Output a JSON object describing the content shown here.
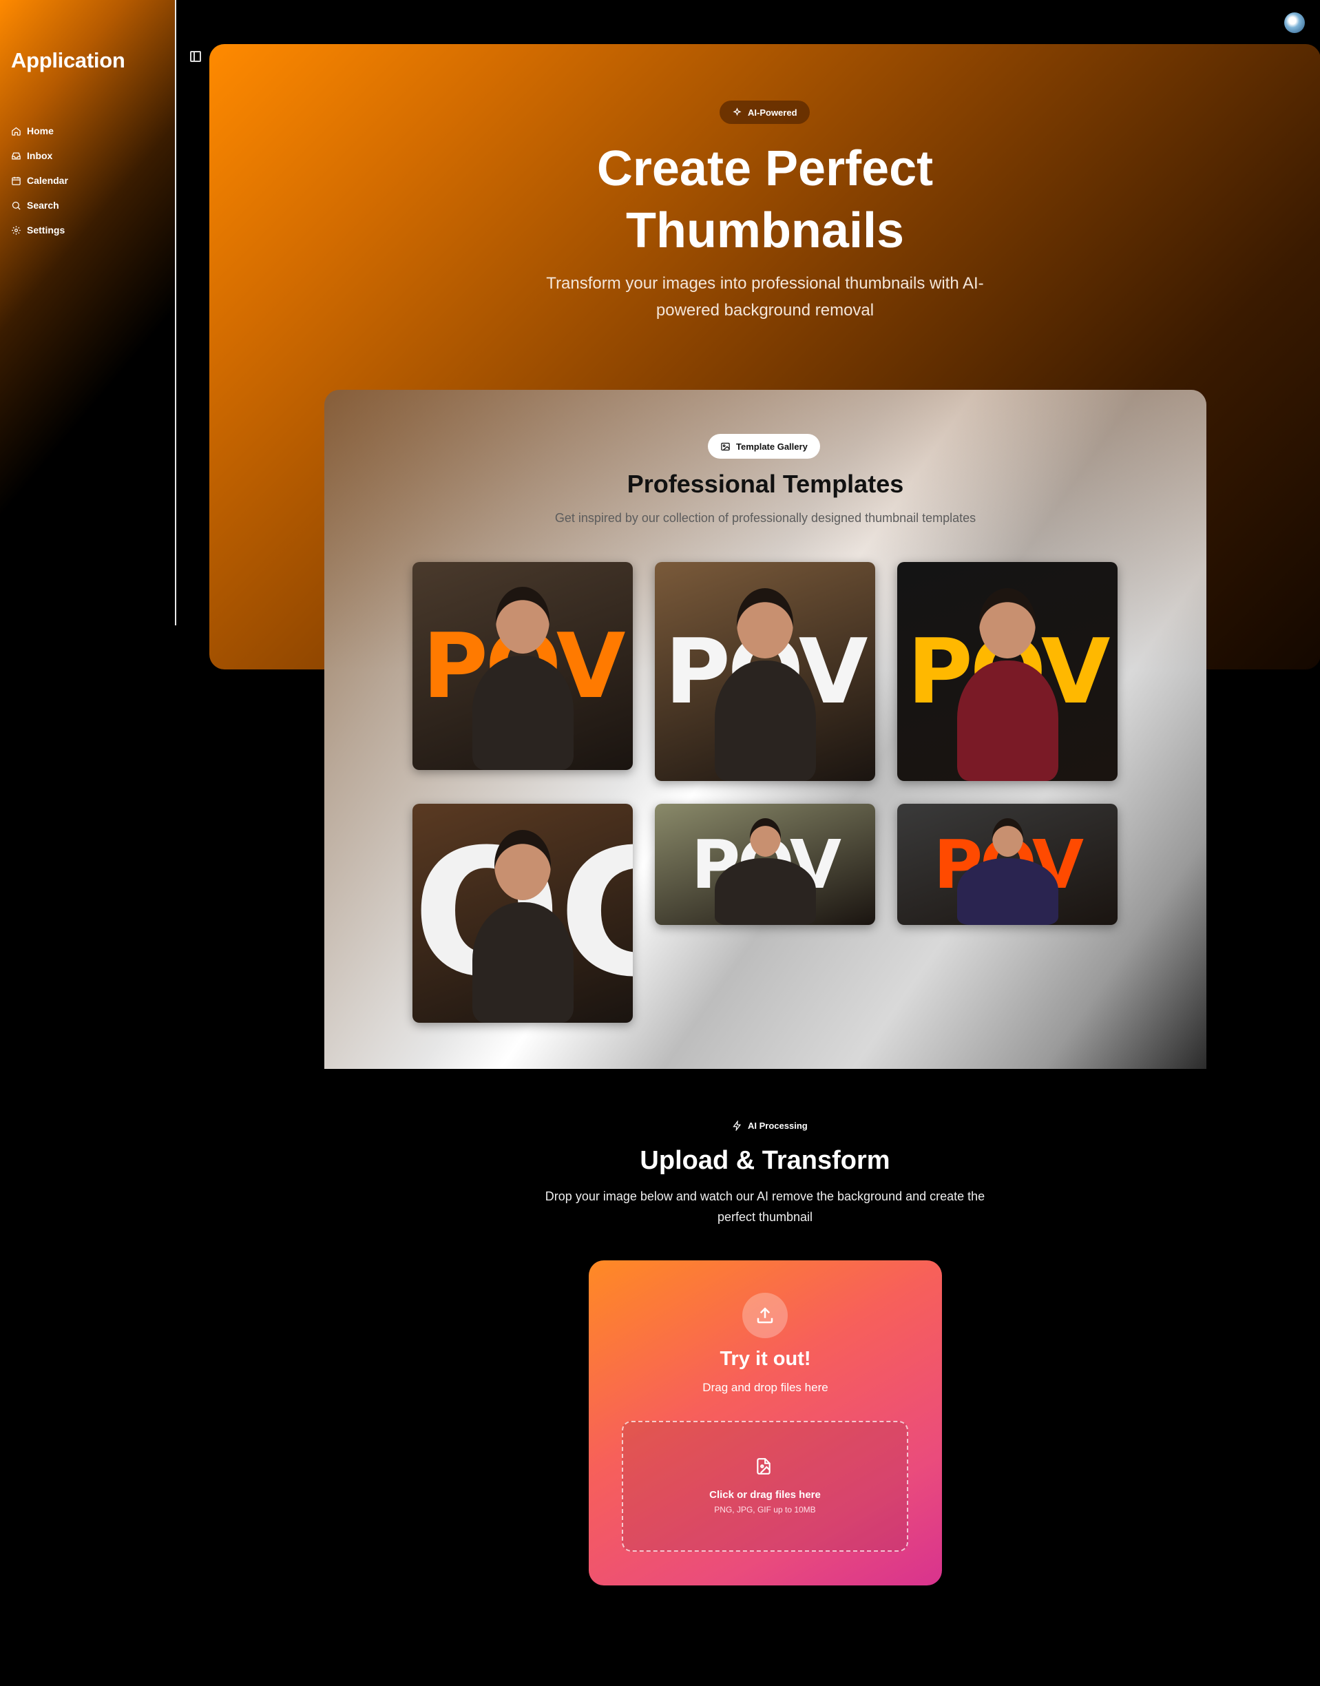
{
  "app": {
    "title": "Application"
  },
  "sidebar": {
    "items": [
      {
        "label": "Home",
        "icon": "home-icon"
      },
      {
        "label": "Inbox",
        "icon": "inbox-icon"
      },
      {
        "label": "Calendar",
        "icon": "calendar-icon"
      },
      {
        "label": "Search",
        "icon": "search-icon"
      },
      {
        "label": "Settings",
        "icon": "gear-icon"
      }
    ]
  },
  "hero": {
    "badge": "AI-Powered",
    "title_line1": "Create Perfect",
    "title_line2": "Thumbnails",
    "subtitle_line1": "Transform your images into professional thumbnails with AI-",
    "subtitle_line2": "powered background removal"
  },
  "templates": {
    "badge": "Template Gallery",
    "title": "Professional Templates",
    "subtitle": "Get inspired by our collection of professionally designed thumbnail templates",
    "items": [
      {
        "text": "POV",
        "text_color": "#ff7a00",
        "bg": "#4a3a2c"
      },
      {
        "text": "POV",
        "text_color": "#f5f5f5",
        "bg": "#7a5a3a"
      },
      {
        "text": "POV",
        "text_color": "#ffb800",
        "bg": "#141414"
      },
      {
        "text": "OG",
        "text_color": "#f2f2f2",
        "bg": "#5a3a22"
      },
      {
        "text": "POV",
        "text_color": "#f5f5f5",
        "bg": "#8a8a6a"
      },
      {
        "text": "POV",
        "text_color": "#ff4a00",
        "bg": "#3a3a3a"
      }
    ]
  },
  "upload": {
    "badge": "AI Processing",
    "title": "Upload & Transform",
    "subtitle_line1": "Drop your image below and watch our AI remove the background and create the",
    "subtitle_line2": "perfect thumbnail",
    "card_title": "Try it out!",
    "card_sub": "Drag and drop files here",
    "drop_label": "Click or drag files here",
    "drop_hint": "PNG, JPG, GIF up to 10MB"
  },
  "colors": {
    "accent": "#ff8a00",
    "upload_start": "#ff8a24",
    "upload_end": "#d8338e"
  }
}
